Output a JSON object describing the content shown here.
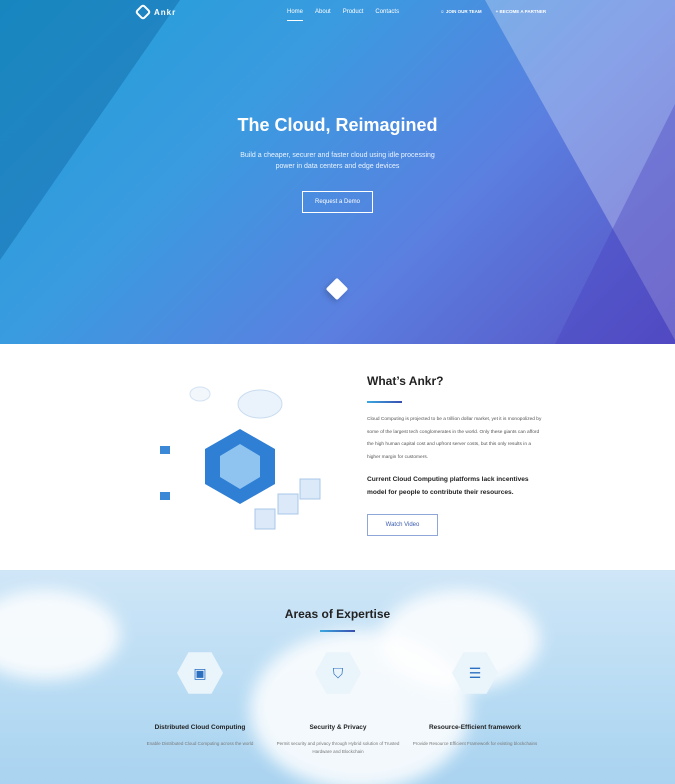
{
  "nav": {
    "brand": "Ankr",
    "links": [
      "Home",
      "About",
      "Product",
      "Contacts"
    ],
    "join": "JOIN OUR TEAM",
    "partner": "BECOME A PARTNER"
  },
  "hero": {
    "title": "The Cloud, Reimagined",
    "subtitle": "Build a cheaper, securer and faster cloud using idle processing power in data centers and edge devices",
    "cta": "Request a Demo"
  },
  "about": {
    "title": "What’s Ankr?",
    "body": "Cloud Computing is projected to be a trillion dollar market, yet it is monopolized by some of the largest tech conglomerates in the world. Only these giants can afford the high human capital cost and upfront server costs, but this only results in a higher margin for customers.",
    "highlight": "Current Cloud Computing platforms lack incentives model for people to contribute their resources.",
    "button": "Watch Video"
  },
  "expertise": {
    "title": "Areas of Expertise",
    "items": [
      {
        "title": "Distributed Cloud Computing",
        "desc": "Enable Distributed Cloud Computing across the world"
      },
      {
        "title": "Security & Privacy",
        "desc": "Permit security and privacy through Hybrid solution of Trusted Hardware and Blockchain"
      },
      {
        "title": "Resource-Efficient framework",
        "desc": "Provide Resource Efficient Framework for existing blockchains"
      }
    ]
  }
}
